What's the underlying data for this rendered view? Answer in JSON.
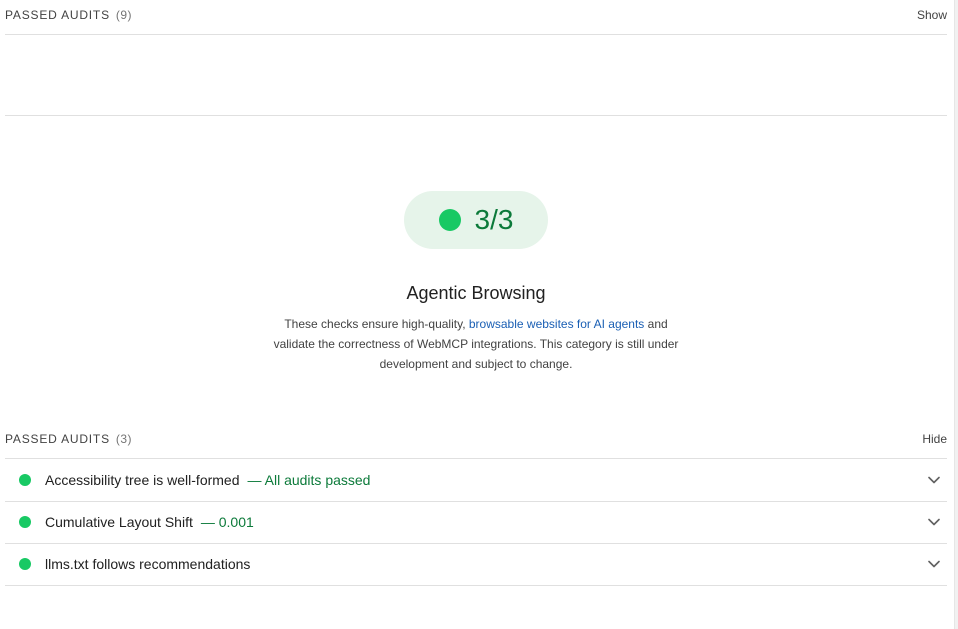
{
  "top_group": {
    "title": "Passed audits",
    "count": "(9)",
    "toggle": "Show"
  },
  "category": {
    "score": "3/3",
    "score_color": "#18c964",
    "title": "Agentic Browsing",
    "desc_before": "These checks ensure high-quality, ",
    "desc_link": "browsable websites for AI agents",
    "desc_after": " and validate the correctness of WebMCP integrations. This category is still under development and subject to change."
  },
  "bottom_group": {
    "title": "Passed audits",
    "count": "(3)",
    "toggle": "Hide",
    "audits": [
      {
        "title": "Accessibility tree is well-formed",
        "value": "— All audits passed",
        "status": "pass"
      },
      {
        "title": "Cumulative Layout Shift",
        "value": "— 0.001",
        "status": "pass"
      },
      {
        "title": "llms.txt follows recommendations",
        "value": "",
        "status": "pass"
      }
    ]
  },
  "icons": {
    "pass": "green-circle",
    "expand": "chevron-down-icon"
  }
}
